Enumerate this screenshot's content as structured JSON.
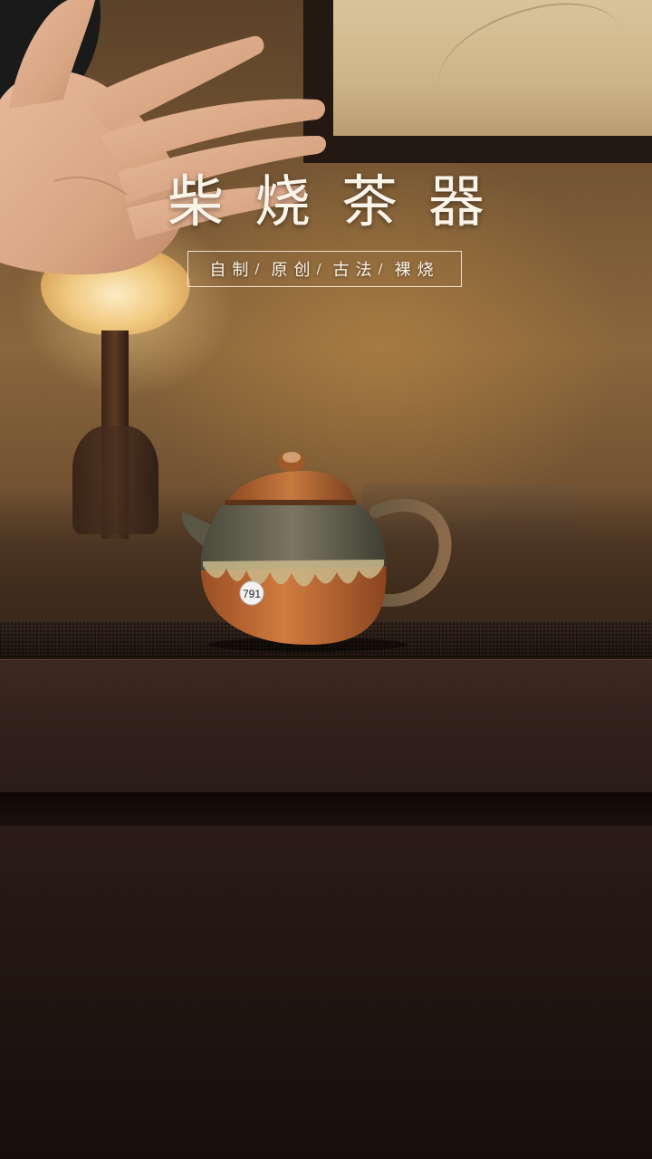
{
  "title": "柴烧茶器",
  "subtitle": {
    "items": [
      "自制",
      "原创",
      "古法",
      "裸烧"
    ],
    "separator": "/"
  },
  "teapot_label": "791",
  "colors": {
    "text": "#fbf4ea",
    "wall": "#8a663c",
    "table": "#33221b",
    "teapot_body": "#c8713a",
    "teapot_glaze": "#6b6a58"
  }
}
